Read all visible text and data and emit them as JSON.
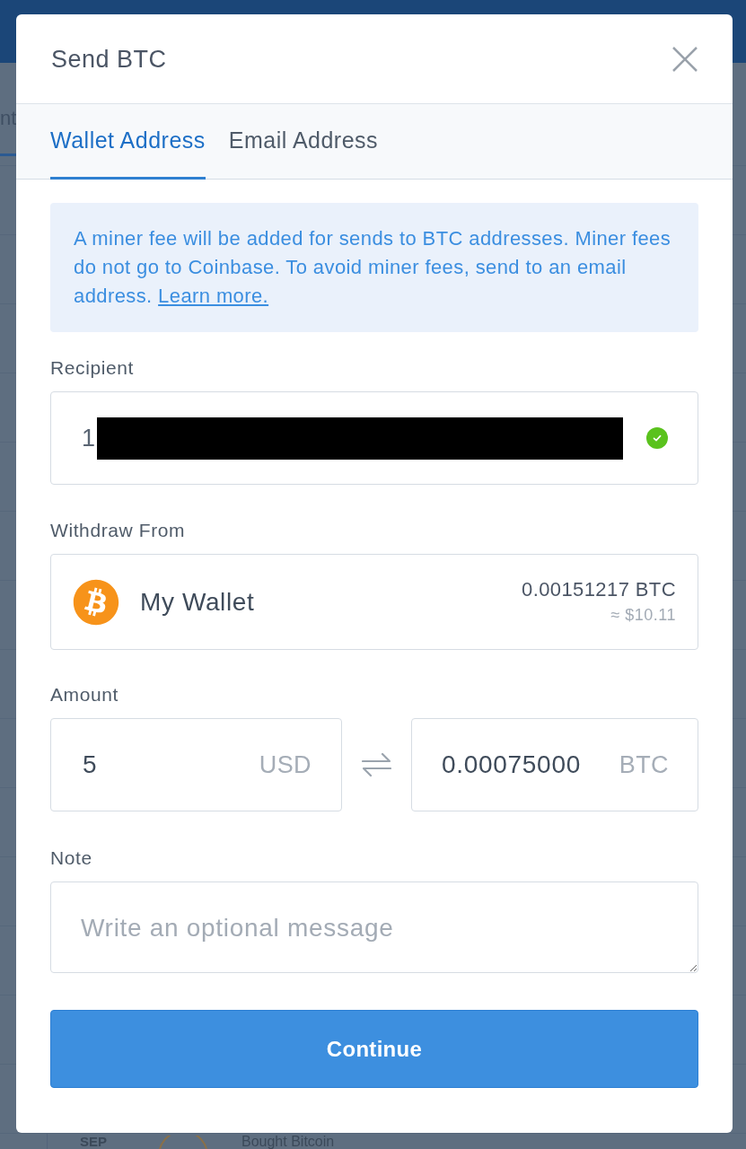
{
  "background_page": {
    "tab_fragment": "nt",
    "activity": [
      {
        "month": "SEP",
        "title": "Bought Bitcoin"
      }
    ]
  },
  "modal": {
    "title": "Send BTC",
    "tabs": [
      {
        "label": "Wallet Address",
        "selected": true
      },
      {
        "label": "Email Address",
        "selected": false
      }
    ],
    "notice": {
      "text": "A miner fee will be added for sends to BTC addresses. Miner fees do not go to Coinbase. To avoid miner fees, send to an email address.",
      "link": "Learn more."
    },
    "recipient": {
      "label": "Recipient",
      "value": "1",
      "redacted": true,
      "valid": true
    },
    "withdraw_from": {
      "label": "Withdraw From",
      "wallet": "My Wallet",
      "balance": "0.00151217 BTC",
      "balance_fiat": "≈ $10.11"
    },
    "amount": {
      "label": "Amount",
      "fiat_value": "5",
      "fiat_currency": "USD",
      "crypto_value": "0.00075000",
      "crypto_currency": "BTC"
    },
    "note": {
      "label": "Note",
      "placeholder": "Write an optional message"
    },
    "submit": "Continue"
  }
}
